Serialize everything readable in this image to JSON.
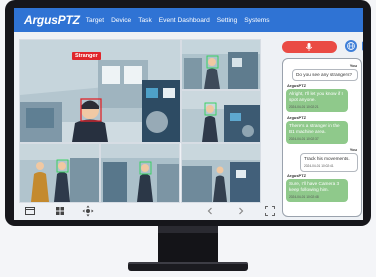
{
  "app": {
    "logo": "ArgusPTZ",
    "nav": [
      "Target",
      "Device",
      "Task",
      "Event Dashboard",
      "Setting",
      "Systems"
    ]
  },
  "feeds": {
    "main_detection_label": "Stranger"
  },
  "toolbar": {
    "icons": [
      "window-icon",
      "grid-icon",
      "ptz-control-icon",
      "previous-icon",
      "next-icon",
      "fullscreen-icon"
    ]
  },
  "chat": {
    "messages": [
      {
        "sender": "You",
        "text": "Do you see any strangers?",
        "timestamp": "",
        "type": "user"
      },
      {
        "sender": "ArgusPTZ",
        "text": "Alright, I'll let you know if I spot anyone.",
        "timestamp": "2024-04-01 10:02:21",
        "type": "bot"
      },
      {
        "sender": "ArgusPTZ",
        "text": "There's a stranger in the B1 machine area.",
        "timestamp": "2024-04-01 10:02:37",
        "type": "bot"
      },
      {
        "sender": "You",
        "text": "Track his movements.",
        "timestamp": "2024-04-01 10:02:41",
        "type": "user"
      },
      {
        "sender": "ArgusPTZ",
        "text": "Sure, I'll have Camera 3 keep following him.",
        "timestamp": "2024-04-01 10:02:48",
        "type": "bot"
      }
    ]
  },
  "colors": {
    "nav_bar": "#2f73d4",
    "mic_button": "#ea4b44",
    "bot_bubble": "#8fc98b",
    "detection_box_stranger": "#e0252b",
    "detection_box_known": "#2fd15a"
  }
}
